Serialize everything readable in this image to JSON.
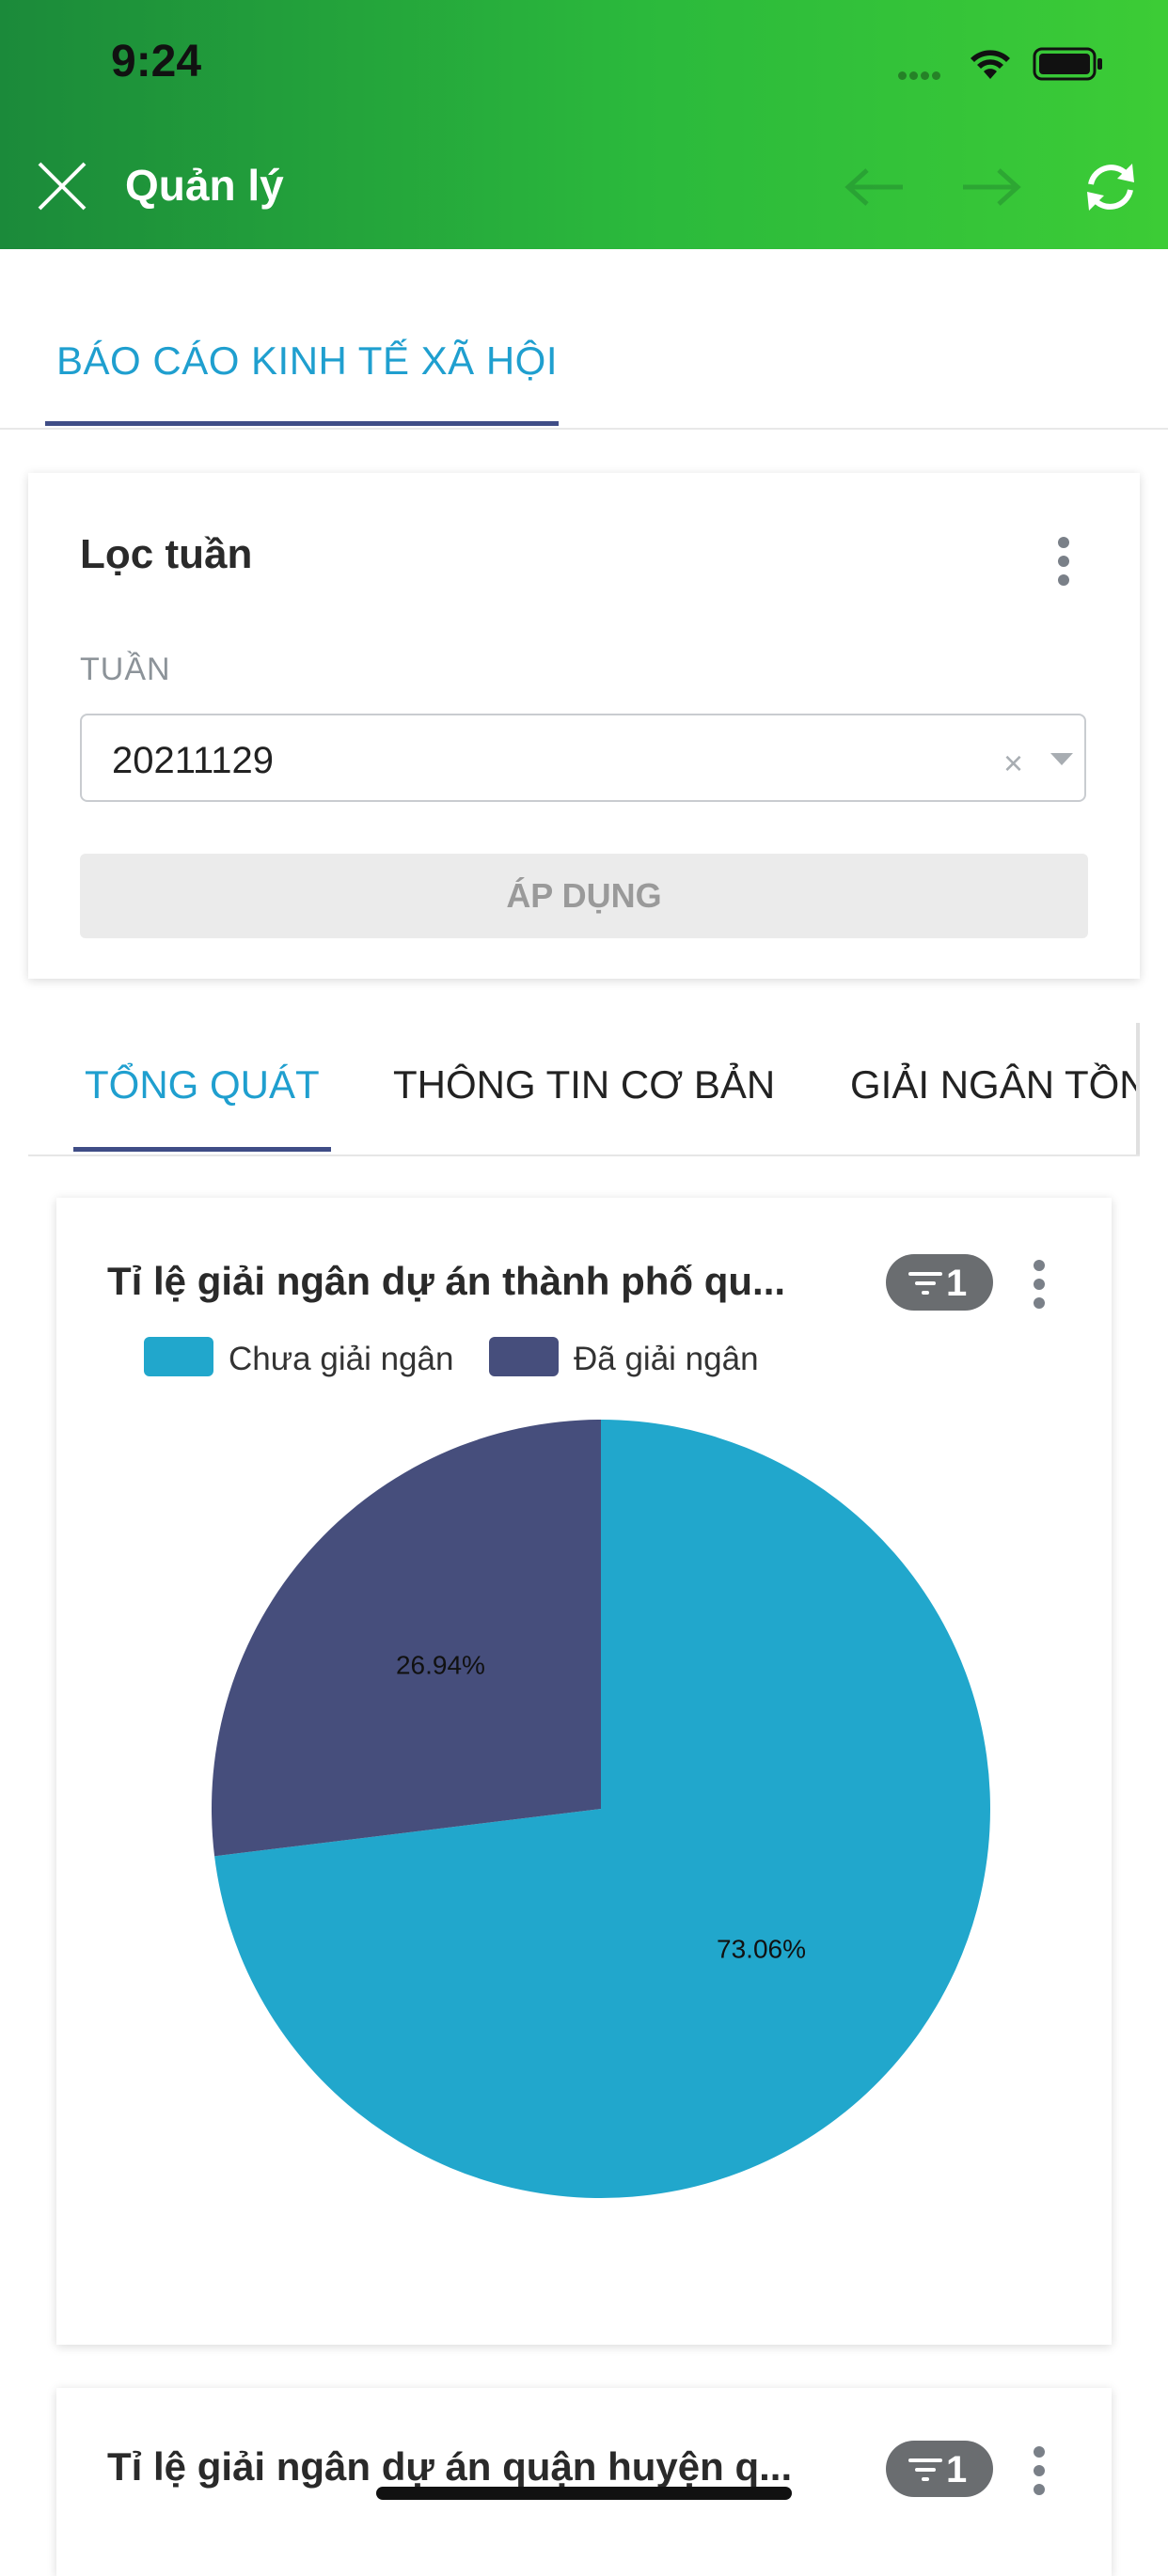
{
  "status_bar": {
    "time": "9:24"
  },
  "header": {
    "title": "Quản lý"
  },
  "top_tab": {
    "label": "BÁO CÁO KINH TẾ XÃ HỘI"
  },
  "filter": {
    "title": "Lọc tuần",
    "field_label": "TUẦN",
    "value": "20211129",
    "clear_symbol": "×",
    "apply_label": "ÁP DỤNG"
  },
  "sub_tabs": [
    {
      "label": "TỔNG QUÁT",
      "active": true
    },
    {
      "label": "THÔNG TIN CƠ BẢN",
      "active": false
    },
    {
      "label": "GIẢI NGÂN TỒN",
      "active": false
    }
  ],
  "chart_card": {
    "title": "Tỉ lệ giải ngân dự án thành phố qu...",
    "filter_count": "1"
  },
  "chart_data": {
    "type": "pie",
    "title": "Tỉ lệ giải ngân dự án thành phố qu...",
    "categories": [
      "Chưa giải ngân",
      "Đã giải ngân"
    ],
    "values": [
      73.06,
      26.94
    ],
    "labels": [
      "73.06%",
      "26.94%"
    ],
    "colors": [
      "#21a7cc",
      "#464e7c"
    ],
    "legend_position": "top-left"
  },
  "second_card": {
    "title": "Tỉ lệ giải ngân dự án quận huyện q...",
    "filter_count": "1"
  },
  "colors": {
    "header_start": "#1b8a3a",
    "header_end": "#3ccc36",
    "accent": "#1f9fcf",
    "tab_indicator": "#3f4d86"
  },
  "icons": [
    "close-icon",
    "arrow-left-icon",
    "arrow-right-icon",
    "refresh-icon",
    "more-vertical-icon",
    "clear-icon",
    "chevron-down-icon",
    "filter-icon",
    "wifi-icon",
    "battery-icon"
  ]
}
